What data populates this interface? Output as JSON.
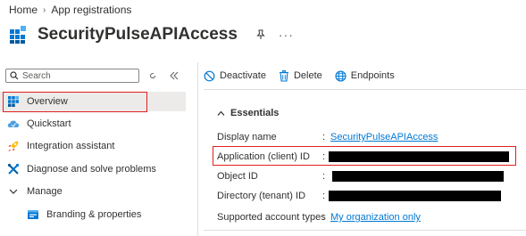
{
  "breadcrumb": {
    "home": "Home",
    "separator": "›",
    "current": "App registrations"
  },
  "header": {
    "title": "SecurityPulseAPIAccess",
    "more": "···"
  },
  "sidebar": {
    "search_placeholder": "Search",
    "items": [
      {
        "label": "Overview",
        "icon": "grid-icon",
        "selected": true
      },
      {
        "label": "Quickstart",
        "icon": "cloud-icon"
      },
      {
        "label": "Integration assistant",
        "icon": "rocket-icon"
      },
      {
        "label": "Diagnose and solve problems",
        "icon": "wrench-icon"
      },
      {
        "label": "Manage",
        "icon": "chevron-down-icon"
      },
      {
        "label": "Branding & properties",
        "icon": "branding-icon"
      }
    ]
  },
  "toolbar": {
    "deactivate": "Deactivate",
    "delete": "Delete",
    "endpoints": "Endpoints"
  },
  "essentials": {
    "title": "Essentials",
    "rows": [
      {
        "label": "Display name",
        "value": "SecurityPulseAPIAccess",
        "link": true
      },
      {
        "label": "Application (client) ID",
        "value": "",
        "redacted": true
      },
      {
        "label": "Object ID",
        "value": "",
        "redacted": true
      },
      {
        "label": "Directory (tenant) ID",
        "value": "",
        "redacted": true
      },
      {
        "label": "Supported account types",
        "value": "My organization only",
        "link": true
      }
    ]
  },
  "colors": {
    "accent": "#0078d4",
    "highlight": "#e02020",
    "selected_bg": "#edebe9"
  }
}
